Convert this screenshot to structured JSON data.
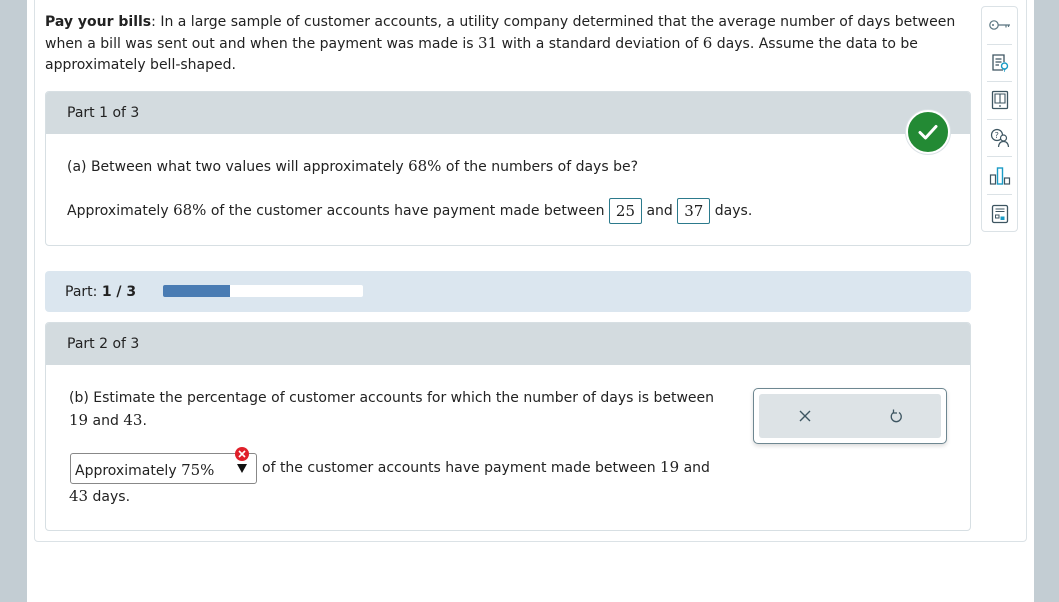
{
  "problem": {
    "title": "Pay your bills",
    "text_1": ": In a large sample of customer accounts, a utility company determined that the average number of days between when a bill was sent out and when the payment was made is ",
    "mean": "31",
    "text_2": " with a standard deviation of ",
    "sd": "6",
    "text_3": " days. Assume the data to be approximately bell-shaped."
  },
  "toolbar": {
    "items": [
      {
        "icon": "key-icon",
        "label": "Answer key"
      },
      {
        "icon": "hint-icon",
        "label": "Hint"
      },
      {
        "icon": "ebook-icon",
        "label": "eBook"
      },
      {
        "icon": "ask-tutor-icon",
        "label": "Ask tutor"
      },
      {
        "icon": "statistics-icon",
        "label": "Data"
      },
      {
        "icon": "calculator-icon",
        "label": "Calculator"
      }
    ]
  },
  "part1": {
    "header": "Part 1 of 3",
    "question_prefix": "(a) Between what two values will approximately ",
    "question_pct": "68%",
    "question_suffix": " of the numbers of days be?",
    "answer_prefix": "Approximately ",
    "answer_pct": "68%",
    "answer_mid": " of the customer accounts have payment made between ",
    "answer_low": "25",
    "answer_and": "and",
    "answer_high": "37",
    "answer_suffix": "days.",
    "status": "correct"
  },
  "progress": {
    "label": "Part:",
    "current": "1 / 3",
    "fraction": 0.333
  },
  "part2": {
    "header": "Part 2 of 3",
    "question_prefix": "(b) Estimate the percentage of customer accounts for which the number of days is between",
    "question_low": "19",
    "question_and": " and ",
    "question_high": "43",
    "question_end": ".",
    "select_prefix": "Approximately ",
    "select_value": "75%",
    "after_select": "of the customer accounts have payment made between ",
    "after_low": "19",
    "after_and": " and",
    "line2_value": "43",
    "line2_suffix": " days.",
    "status": "incorrect"
  },
  "colors": {
    "correct": "#238a34",
    "incorrect": "#e0202a",
    "progress": "#4a7cb3",
    "accent": "#2c7a8c"
  }
}
